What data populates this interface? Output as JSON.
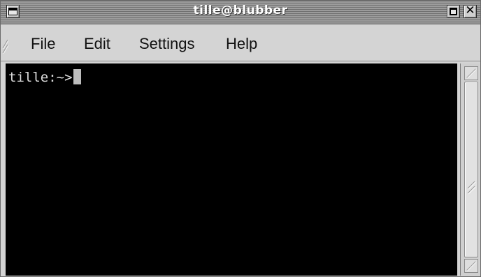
{
  "window": {
    "title": "tille@blubber"
  },
  "titlebar_buttons": {
    "menu_icon": "window-menu-icon",
    "maximize_icon": "maximize-icon",
    "close_icon": "close-icon",
    "close_glyph": "✕"
  },
  "menu": {
    "items": [
      {
        "label": "File"
      },
      {
        "label": "Edit"
      },
      {
        "label": "Settings"
      },
      {
        "label": "Help"
      }
    ]
  },
  "terminal": {
    "prompt": "tille:~>",
    "background": "#000000",
    "foreground": "#dcdcdc"
  },
  "colors": {
    "chrome": "#d4d4d4",
    "titlebar": "#8a8a8a"
  }
}
